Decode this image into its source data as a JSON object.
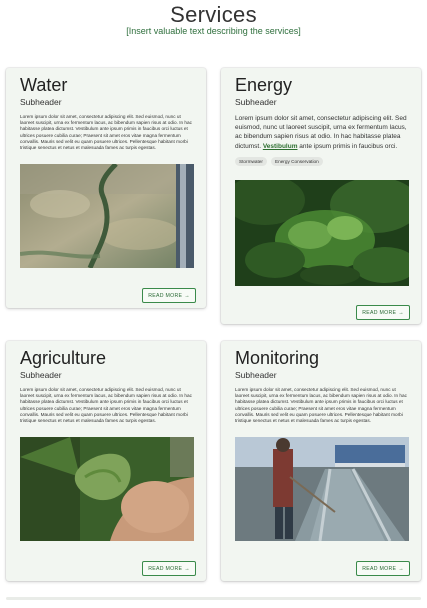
{
  "page": {
    "title": "Services",
    "subtitle": "[Insert valuable text describing the services]"
  },
  "cards": [
    {
      "title": "Water",
      "subheader": "Subheader",
      "body": "Lorem ipsum dolor sit amet, consectetur adipiscing elit. Sed euismod, nunc ut laoreet suscipit, urna ex fermentum lacus, ac bibendum sapien risus at odio. In hac habitasse platea dictumst. Vestibulum ante ipsum primis in faucibus orci luctus et ultrices posuere cubilia curae; Praesent sit amet eros vitae magna fermentum convallis. Mauris sed velit eu quam posuere ultrices. Pellentesque habitant morbi tristique senectus et netus et malesuada fames ac turpis egestas.",
      "image_alt": "water-image",
      "button": "READ MORE",
      "button_icon": "arrow-right-icon"
    },
    {
      "title": "Energy",
      "subheader": "Subheader",
      "body_before": "Lorem ipsum dolor sit amet, consectetur adipiscing elit. Sed euismod, nunc ut laoreet suscipit, urna ex fermentum lacus, ac bibendum sapien risus at odio. In hac habitasse platea dictumst. ",
      "link": "Vestibulum",
      "body_after": " ante ipsum primis in faucibus orci.",
      "chips": [
        "Stormwater",
        "Energy Conservation"
      ],
      "image_alt": "energy-image",
      "button": "READ MORE",
      "button_icon": "arrow-right-icon"
    },
    {
      "title": "Agriculture",
      "subheader": "Subheader",
      "body": "Lorem ipsum dolor sit amet, consectetur adipiscing elit. Sed euismod, nunc ut laoreet suscipit, urna ex fermentum lacus, ac bibendum sapien risus at odio. In hac habitasse platea dictumst. Vestibulum ante ipsum primis in faucibus orci luctus et ultrices posuere cubilia curae; Praesent sit amet eros vitae magna fermentum convallis. Mauris sed velit eu quam posuere ultrices. Pellentesque habitant morbi tristique senectus et netus et malesuada fames ac turpis egestas.",
      "image_alt": "agriculture-image",
      "button": "READ MORE",
      "button_icon": "arrow-right-icon"
    },
    {
      "title": "Monitoring",
      "subheader": "Subheader",
      "body": "Lorem ipsum dolor sit amet, consectetur adipiscing elit. Sed euismod, nunc ut laoreet suscipit, urna ex fermentum lacus, ac bibendum sapien risus at odio. In hac habitasse platea dictumst. Vestibulum ante ipsum primis in faucibus orci luctus et ultrices posuere cubilia curae; Praesent sit amet eros vitae magna fermentum convallis. Mauris sed velit eu quam posuere ultrices. Pellentesque habitant morbi tristique senectus et netus et malesuada fames ac turpis egestas.",
      "image_alt": "monitoring-image",
      "button": "READ MORE",
      "button_icon": "arrow-right-icon"
    }
  ],
  "colors": {
    "accent": "#2c6e2f",
    "card_bg": "#f2f6f1"
  }
}
